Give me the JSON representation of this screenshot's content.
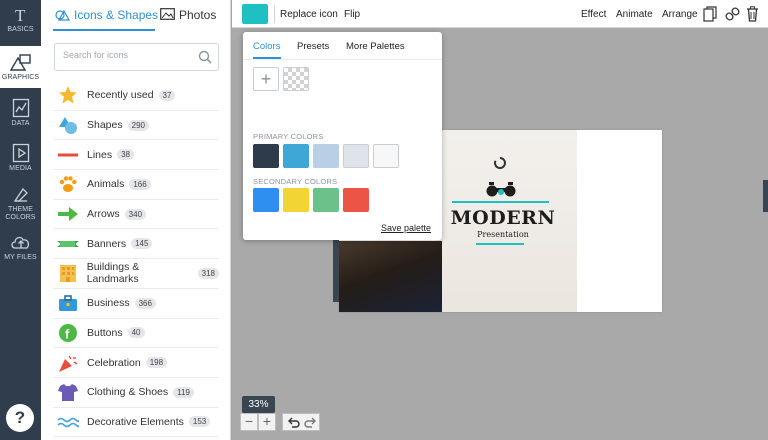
{
  "sidebar_rail": {
    "items": [
      {
        "label": "BASICS",
        "icon": "basics-icon"
      },
      {
        "label": "GRAPHICS",
        "icon": "graphics-icon"
      },
      {
        "label": "DATA",
        "icon": "data-icon"
      },
      {
        "label": "MEDIA",
        "icon": "media-icon"
      },
      {
        "label": "THEME",
        "label2": "COLORS",
        "icon": "theme-colors-icon"
      },
      {
        "label": "MY FILES",
        "icon": "cloud-upload-icon"
      }
    ],
    "help_label": "?"
  },
  "icons_panel": {
    "tabs": [
      {
        "label": "Icons & Shapes"
      },
      {
        "label": "Photos"
      }
    ],
    "search": {
      "placeholder": "Search for icons",
      "value": ""
    },
    "categories": [
      {
        "label": "Recently used",
        "count": "37",
        "icon": "star-icon",
        "color": "#f5b82e"
      },
      {
        "label": "Shapes",
        "count": "290",
        "icon": "shapes-icon",
        "color": "#3fa6d8"
      },
      {
        "label": "Lines",
        "count": "38",
        "icon": "line-icon",
        "color": "#e74c3c"
      },
      {
        "label": "Animals",
        "count": "166",
        "icon": "paw-icon",
        "color": "#f39c12"
      },
      {
        "label": "Arrows",
        "count": "340",
        "icon": "arrow-right-icon",
        "color": "#4cb944"
      },
      {
        "label": "Banners",
        "count": "145",
        "icon": "banner-icon",
        "color": "#5cc469"
      },
      {
        "label": "Buildings & Landmarks",
        "count": "318",
        "icon": "building-icon",
        "color": "#f5c14b"
      },
      {
        "label": "Business",
        "count": "366",
        "icon": "briefcase-icon",
        "color": "#3498db"
      },
      {
        "label": "Buttons",
        "count": "40",
        "icon": "facebook-button-icon",
        "color": "#4cb944"
      },
      {
        "label": "Celebration",
        "count": "198",
        "icon": "party-popper-icon",
        "color": "#e74c3c"
      },
      {
        "label": "Clothing & Shoes",
        "count": "119",
        "icon": "tshirt-icon",
        "color": "#6b5bb5"
      },
      {
        "label": "Decorative Elements",
        "count": "153",
        "icon": "wave-icon",
        "color": "#4aa3df"
      }
    ]
  },
  "toolbar": {
    "accent_color": "#1ec0c4",
    "replace_label": "Replace icon",
    "flip_label": "Flip",
    "effect_label": "Effect",
    "animate_label": "Animate",
    "arrange_label": "Arrange"
  },
  "color_popup": {
    "tabs": [
      {
        "label": "Colors"
      },
      {
        "label": "Presets"
      },
      {
        "label": "More Palettes"
      }
    ],
    "add_label": "+",
    "primary_label": "PRIMARY COLORS",
    "primary_colors": [
      "#2e3b4a",
      "#3fa7d6",
      "#b9cfe6",
      "#dfe4ea",
      "#f7f7f7"
    ],
    "secondary_label": "SECONDARY COLORS",
    "secondary_colors": [
      "#2f8ff0",
      "#f2d535",
      "#6cc08a",
      "#eb5545"
    ],
    "save_label": "Save palette"
  },
  "slide": {
    "title": "MODERN",
    "subtitle": "Presentation"
  },
  "zoom": {
    "level": "33%",
    "minus": "−",
    "plus": "+"
  }
}
